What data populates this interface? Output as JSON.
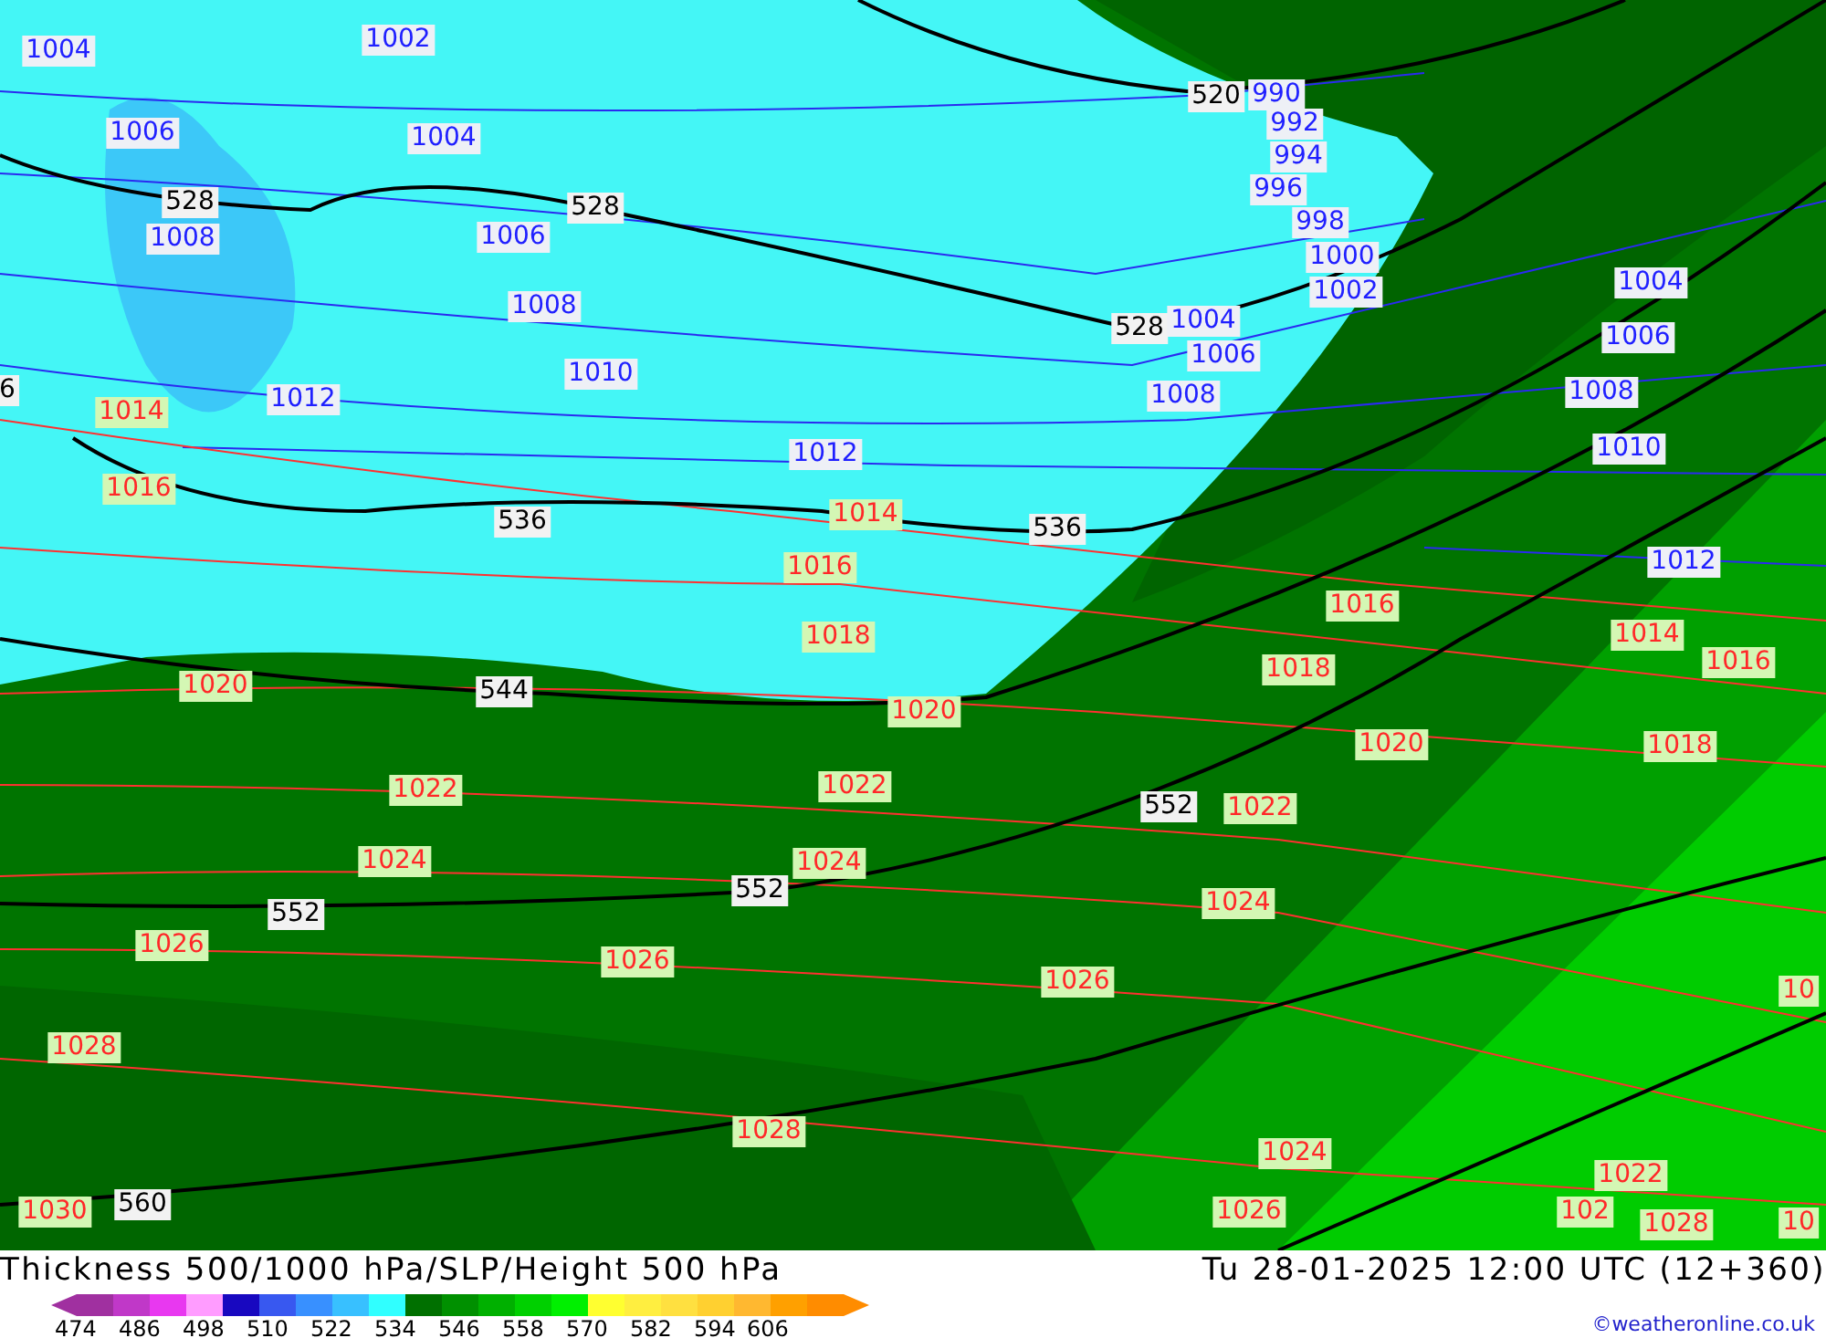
{
  "map": {
    "labels": [
      {
        "text": "1004",
        "kind": "isobar_low"
      },
      {
        "text": "1002",
        "kind": "isobar_low"
      },
      {
        "text": "1006",
        "kind": "isobar_low"
      },
      {
        "text": "1004",
        "kind": "isobar_low"
      },
      {
        "text": "528",
        "kind": "height"
      },
      {
        "text": "1008",
        "kind": "isobar_low"
      },
      {
        "text": "528",
        "kind": "height"
      },
      {
        "text": "1006",
        "kind": "isobar_low"
      },
      {
        "text": "1008",
        "kind": "isobar_low"
      },
      {
        "text": "1010",
        "kind": "isobar_low"
      },
      {
        "text": "520",
        "kind": "height"
      },
      {
        "text": "990",
        "kind": "isobar_low"
      },
      {
        "text": "992",
        "kind": "isobar_low"
      },
      {
        "text": "994",
        "kind": "isobar_low"
      },
      {
        "text": "996",
        "kind": "isobar_low"
      },
      {
        "text": "998",
        "kind": "isobar_low"
      },
      {
        "text": "1000",
        "kind": "isobar_low"
      },
      {
        "text": "1002",
        "kind": "isobar_low"
      },
      {
        "text": "528",
        "kind": "height"
      },
      {
        "text": "1004",
        "kind": "isobar_low"
      },
      {
        "text": "1006",
        "kind": "isobar_low"
      },
      {
        "text": "1008",
        "kind": "isobar_low"
      },
      {
        "text": "1004",
        "kind": "isobar_low"
      },
      {
        "text": "1006",
        "kind": "isobar_low"
      },
      {
        "text": "1008",
        "kind": "isobar_low"
      },
      {
        "text": "1010",
        "kind": "isobar_low"
      },
      {
        "text": "1012",
        "kind": "isobar_low"
      },
      {
        "text": "6",
        "kind": "height"
      },
      {
        "text": "1014",
        "kind": "isobar_high"
      },
      {
        "text": "1012",
        "kind": "isobar_low"
      },
      {
        "text": "1016",
        "kind": "isobar_high"
      },
      {
        "text": "1012",
        "kind": "isobar_low"
      },
      {
        "text": "1014",
        "kind": "isobar_high"
      },
      {
        "text": "536",
        "kind": "height"
      },
      {
        "text": "536",
        "kind": "height"
      },
      {
        "text": "1016",
        "kind": "isobar_high"
      },
      {
        "text": "1018",
        "kind": "isobar_high"
      },
      {
        "text": "1016",
        "kind": "isobar_high"
      },
      {
        "text": "1014",
        "kind": "isobar_high"
      },
      {
        "text": "1016",
        "kind": "isobar_high"
      },
      {
        "text": "1020",
        "kind": "isobar_high"
      },
      {
        "text": "544",
        "kind": "height"
      },
      {
        "text": "1020",
        "kind": "isobar_high"
      },
      {
        "text": "1018",
        "kind": "isobar_high"
      },
      {
        "text": "1020",
        "kind": "isobar_high"
      },
      {
        "text": "1018",
        "kind": "isobar_high"
      },
      {
        "text": "1022",
        "kind": "isobar_high"
      },
      {
        "text": "1022",
        "kind": "isobar_high"
      },
      {
        "text": "552",
        "kind": "height"
      },
      {
        "text": "1022",
        "kind": "isobar_high"
      },
      {
        "text": "1024",
        "kind": "isobar_high"
      },
      {
        "text": "1024",
        "kind": "isobar_high"
      },
      {
        "text": "552",
        "kind": "height"
      },
      {
        "text": "552",
        "kind": "height"
      },
      {
        "text": "1024",
        "kind": "isobar_high"
      },
      {
        "text": "1026",
        "kind": "isobar_high"
      },
      {
        "text": "1026",
        "kind": "isobar_high"
      },
      {
        "text": "1026",
        "kind": "isobar_high"
      },
      {
        "text": "10",
        "kind": "isobar_high"
      },
      {
        "text": "1028",
        "kind": "isobar_high"
      },
      {
        "text": "1028",
        "kind": "isobar_high"
      },
      {
        "text": "1024",
        "kind": "isobar_high"
      },
      {
        "text": "1022",
        "kind": "isobar_high"
      },
      {
        "text": "1030",
        "kind": "isobar_high"
      },
      {
        "text": "560",
        "kind": "height"
      },
      {
        "text": "1026",
        "kind": "isobar_high"
      },
      {
        "text": "102",
        "kind": "isobar_high"
      },
      {
        "text": "1028",
        "kind": "isobar_high"
      },
      {
        "text": "10",
        "kind": "isobar_high"
      }
    ]
  },
  "footer": {
    "title": "Thickness 500/1000 hPa/SLP/Height 500 hPa",
    "datetime": "Tu 28-01-2025 12:00 UTC (12+360)",
    "copyright": "©weatheronline.co.uk",
    "legend": {
      "swatches": [
        {
          "color": "#a030a0"
        },
        {
          "color": "#c038c8"
        },
        {
          "color": "#e838f0"
        },
        {
          "color": "#ff9cff"
        },
        {
          "color": "#1808c0"
        },
        {
          "color": "#3858f0"
        },
        {
          "color": "#3890ff"
        },
        {
          "color": "#38c0ff"
        },
        {
          "color": "#30ffff"
        },
        {
          "color": "#007000"
        },
        {
          "color": "#009000"
        },
        {
          "color": "#00b000"
        },
        {
          "color": "#00d000"
        },
        {
          "color": "#00f000"
        },
        {
          "color": "#ffff30"
        },
        {
          "color": "#ffee40"
        },
        {
          "color": "#ffe040"
        },
        {
          "color": "#ffd030"
        },
        {
          "color": "#ffb830"
        },
        {
          "color": "#ffa000"
        },
        {
          "color": "#ff8c00"
        }
      ],
      "ticks": [
        "474",
        "486",
        "498",
        "510",
        "522",
        "534",
        "546",
        "558",
        "570",
        "582",
        "594",
        "606"
      ]
    }
  }
}
